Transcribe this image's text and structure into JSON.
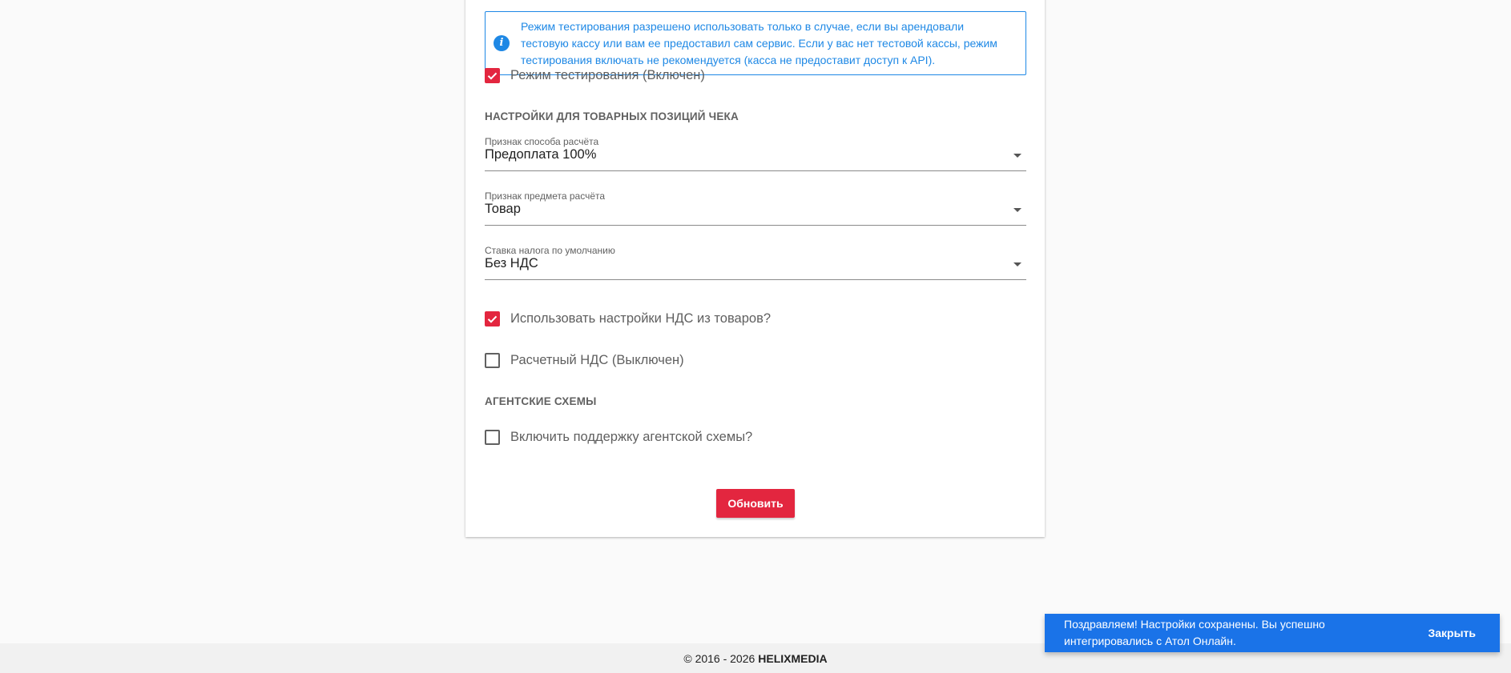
{
  "info_alert": {
    "icon": "info-icon",
    "color": "#1e88e5",
    "text": "Режим тестирования разрешено использовать только в случае, если вы арендовали тестовую кассу или вам ее предоставил сам сервис. Если у вас нет тестовой кассы, режим тестирования включать не рекомендуется (касса не предоставит доступ к API)."
  },
  "test_mode": {
    "label": "Режим тестирования (Включен)",
    "checked": true
  },
  "receipt_items_section": {
    "title": "НАСТРОЙКИ ДЛЯ ТОВАРНЫХ ПОЗИЦИЙ ЧЕКА",
    "payment_method": {
      "caption": "Признак способа расчёта",
      "value": "Предоплата 100%"
    },
    "payment_object": {
      "caption": "Признак предмета расчёта",
      "value": "Товар"
    },
    "tax_rate": {
      "caption": "Ставка налога по умолчанию",
      "value": "Без НДС"
    },
    "use_product_vat": {
      "label": "Использовать настройки НДС из товаров?",
      "checked": true
    },
    "calculated_vat": {
      "label": "Расчетный НДС (Выключен)",
      "checked": false
    }
  },
  "agent_section": {
    "title": "АГЕНТСКИЕ СХЕМЫ",
    "enable_agent": {
      "label": "Включить поддержку агентской схемы?",
      "checked": false
    }
  },
  "update_button": {
    "label": "Обновить"
  },
  "footer": {
    "copyright": "© 2016 - 2026",
    "brand": "HELIXMEDIA"
  },
  "snackbar": {
    "message": "Поздравляем! Настройки сохранены. Вы успешно интегрировались с Атол Онлайн.",
    "close_label": "Закрыть",
    "color": "#1a73e8"
  },
  "accent_color": "#e3263f"
}
